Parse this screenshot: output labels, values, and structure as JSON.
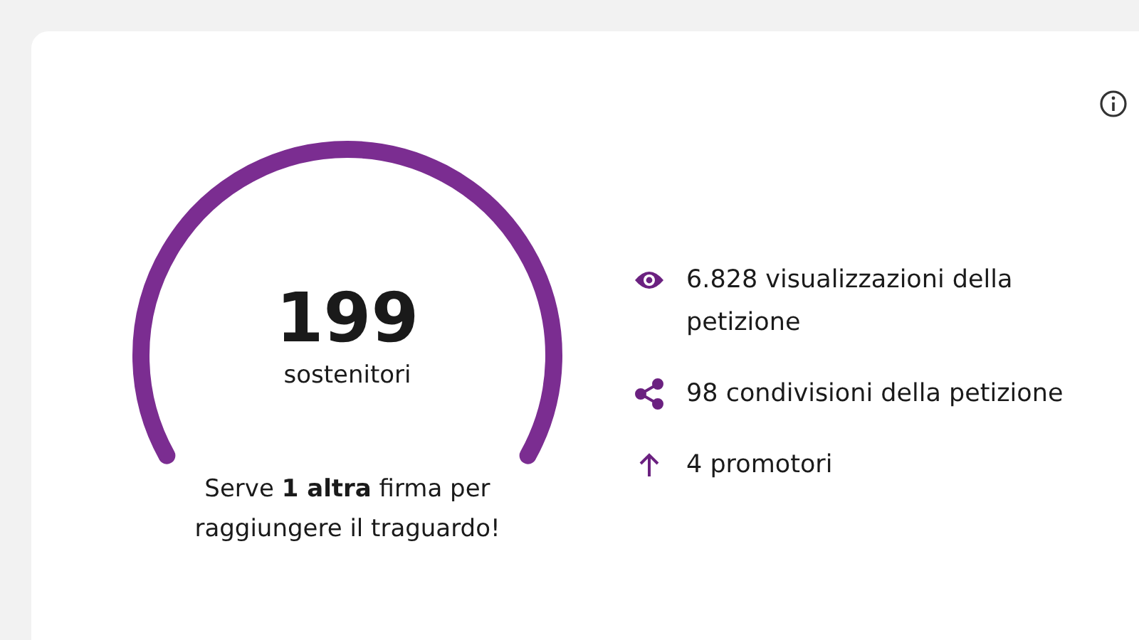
{
  "gauge": {
    "count": "199",
    "label": "sostenitori"
  },
  "goal_message": "Serve **1 altra** firma per raggiungere il traguardo!",
  "stats": [
    {
      "kind": "views",
      "text": "6.828 visualizzazioni della petizione"
    },
    {
      "kind": "shares",
      "text": "98 condivisioni della petizione"
    },
    {
      "kind": "promoters",
      "text": "4 promotori"
    }
  ]
}
